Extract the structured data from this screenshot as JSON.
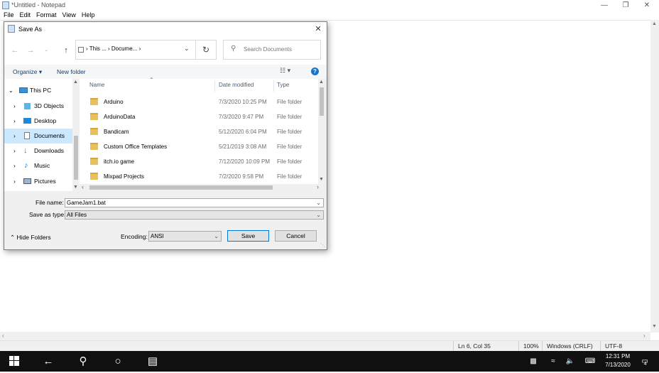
{
  "notepad": {
    "title": "*Untitled - Notepad",
    "menu": [
      "File",
      "Edit",
      "Format",
      "View",
      "Help"
    ],
    "status": {
      "position": "Ln 6, Col 35",
      "zoom": "100%",
      "line_ending": "Windows (CRLF)",
      "encoding": "UTF-8"
    }
  },
  "dialog": {
    "title": "Save As",
    "address": [
      "This ...",
      "Docume...",
      ""
    ],
    "search_placeholder": "Search Documents",
    "commands": {
      "organize": "Organize ▾",
      "new_folder": "New folder"
    },
    "tree": [
      {
        "label": "This PC",
        "icon": "pc-icon"
      },
      {
        "label": "3D Objects",
        "icon": "3d-objects-icon"
      },
      {
        "label": "Desktop",
        "icon": "desktop-icon"
      },
      {
        "label": "Documents",
        "icon": "documents-icon",
        "selected": true
      },
      {
        "label": "Downloads",
        "icon": "downloads-icon"
      },
      {
        "label": "Music",
        "icon": "music-icon"
      },
      {
        "label": "Pictures",
        "icon": "pictures-icon"
      }
    ],
    "columns": {
      "name": "Name",
      "date": "Date modified",
      "type": "Type"
    },
    "files": [
      {
        "name": "Arduino",
        "date": "7/3/2020 10:25 PM",
        "type": "File folder"
      },
      {
        "name": "ArduinoData",
        "date": "7/3/2020 9:47 PM",
        "type": "File folder"
      },
      {
        "name": "Bandicam",
        "date": "5/12/2020 6:04 PM",
        "type": "File folder"
      },
      {
        "name": "Custom Office Templates",
        "date": "5/21/2019 3:08 AM",
        "type": "File folder"
      },
      {
        "name": "itch.io game",
        "date": "7/12/2020 10:09 PM",
        "type": "File folder"
      },
      {
        "name": "Mixpad Projects",
        "date": "7/2/2020 9:58 PM",
        "type": "File folder"
      }
    ],
    "file_name_label": "File name:",
    "file_name_value": "GameJam1.bat",
    "save_type_label": "Save as type:",
    "save_type_value": "All Files",
    "hide_folders": "Hide Folders",
    "encoding_label": "Encoding:",
    "encoding_value": "ANSI",
    "save": "Save",
    "cancel": "Cancel"
  },
  "taskbar": {
    "time": "12:31 PM",
    "date": "7/13/2020",
    "notifications": "4"
  }
}
